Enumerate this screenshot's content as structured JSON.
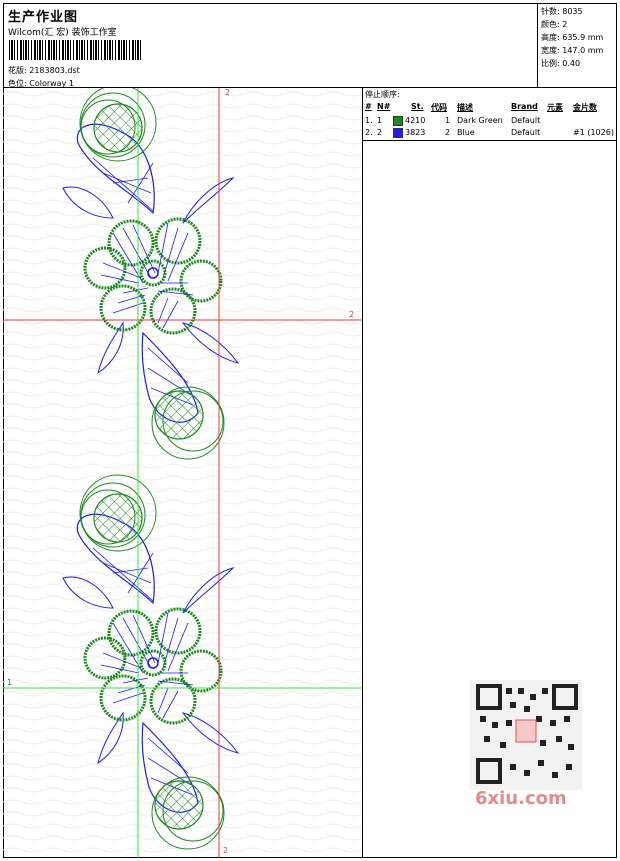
{
  "header": {
    "title": "生产作业图",
    "studio": "Wilcom(汇 宏) 装饰工作室",
    "design_label": "花版:",
    "design_value": "2183803.dst",
    "colorway_label": "色位:",
    "colorway_value": "Colorway 1"
  },
  "stats": {
    "stitches_label": "针数:",
    "stitches_value": "8035",
    "colors_label": "颜色:",
    "colors_value": "2",
    "height_label": "高度:",
    "height_value": "635.9 mm",
    "width_label": "宽度:",
    "width_value": "147.0 mm",
    "scale_label": "比例:",
    "scale_value": "0.40"
  },
  "stop_sequence": {
    "title": "停止顺序:",
    "headers": [
      "#",
      "N#",
      "St.",
      "代码",
      "描述",
      "Brand",
      "元素",
      "金片数"
    ],
    "rows": [
      {
        "idx": "1.",
        "n": "1",
        "st": "4210",
        "code": "1",
        "desc": "Dark Green",
        "brand": "Default",
        "elem": "",
        "sequins": "",
        "color": "#1a8a1a"
      },
      {
        "idx": "2.",
        "n": "2",
        "st": "3823",
        "code": "2",
        "desc": "Blue",
        "brand": "Default",
        "elem": "",
        "sequins": "#1 (1026)",
        "color": "#1a1aff"
      }
    ]
  },
  "canvas": {
    "marker_top": "2",
    "marker_right": "2",
    "marker_left": "1",
    "marker_bottom": "2"
  },
  "watermark": "6xiu.com"
}
